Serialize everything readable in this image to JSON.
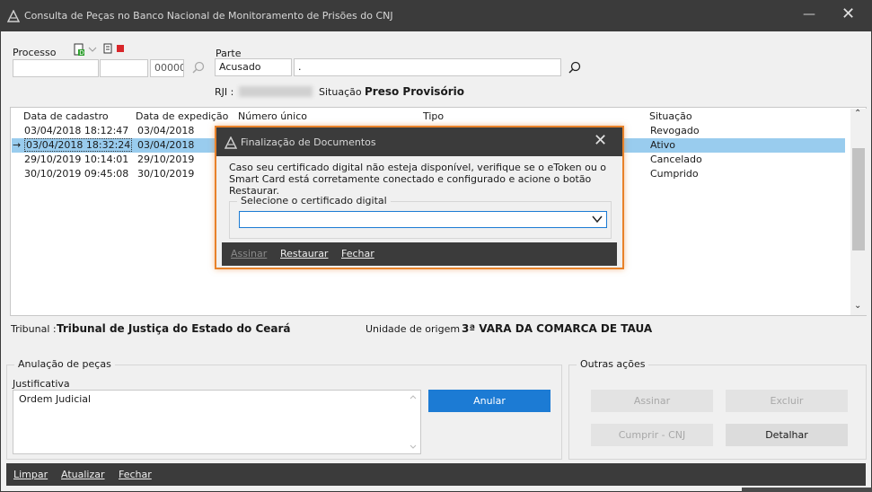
{
  "window": {
    "title": "Consulta de Peças no Banco Nacional de Monitoramento de Prisões do CNJ",
    "minimize": "—",
    "close": "✕"
  },
  "processo": {
    "label": "Processo",
    "number_suffix": "00000"
  },
  "parte": {
    "label": "Parte",
    "type_value": "Acusado",
    "name_value": "."
  },
  "rji": {
    "label": "RJI :",
    "situacao_label": "Situação :",
    "situacao_value": "Preso Provisório"
  },
  "table": {
    "columns": [
      "Data de cadastro",
      "Data de expedição",
      "Número único",
      "Tipo",
      "Situação"
    ],
    "rows": [
      {
        "marker": "",
        "cadastro": "03/04/2018 18:12:47",
        "expedicao": "03/04/2018",
        "situacao": "Revogado",
        "selected": false
      },
      {
        "marker": "→",
        "cadastro": "03/04/2018 18:32:24",
        "expedicao": "03/04/2018",
        "situacao": "Ativo",
        "selected": true
      },
      {
        "marker": "",
        "cadastro": "29/10/2019 10:14:01",
        "expedicao": "29/10/2019",
        "situacao": "Cancelado",
        "selected": false
      },
      {
        "marker": "",
        "cadastro": "30/10/2019 09:45:08",
        "expedicao": "30/10/2019",
        "situacao": "Cumprido",
        "selected": false
      }
    ]
  },
  "dialog": {
    "title": "Finalização de Documentos",
    "message": "Caso seu certificado digital não esteja disponível, verifique se o eToken ou o Smart Card está corretamente conectado e configurado e acione o botão Restaurar.",
    "group_label": "Selecione o certificado digital",
    "selected_value": "",
    "buttons": {
      "assinar": "Assinar",
      "restaurar": "Restaurar",
      "fechar": "Fechar"
    }
  },
  "info": {
    "tribunal_label": "Tribunal :",
    "tribunal_value": "Tribunal de Justiça do Estado do Ceará",
    "unidade_label": "Unidade de origem :",
    "unidade_value": "3ª VARA DA COMARCA DE TAUA"
  },
  "anulacao": {
    "section_label": "Anulação de peças",
    "justificativa_label": "Justificativa",
    "justificativa_value": "Ordem Judicial",
    "anular_button": "Anular"
  },
  "outras": {
    "section_label": "Outras ações",
    "assinar": "Assinar",
    "excluir": "Excluir",
    "cumprir": "Cumprir - CNJ",
    "detalhar": "Detalhar"
  },
  "footer": {
    "limpar": "Limpar",
    "atualizar": "Atualizar",
    "fechar": "Fechar"
  },
  "colors": {
    "titlebar": "#3b3b3b",
    "accent_blue": "#1c7bd4",
    "selection": "#99ccee",
    "dialog_border": "#e8822a"
  }
}
